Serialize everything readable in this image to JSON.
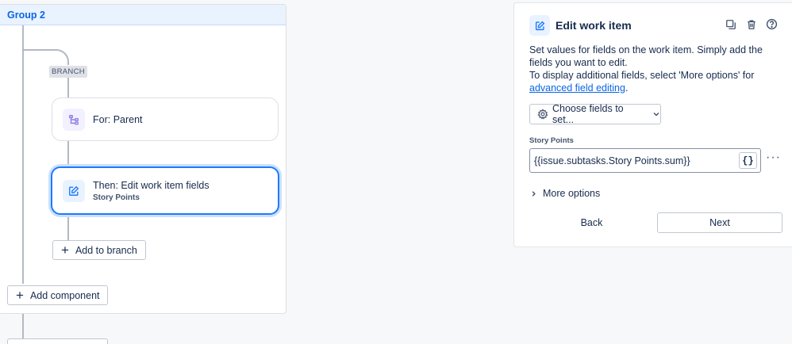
{
  "group": {
    "title": "Group 2"
  },
  "branch": {
    "tag": "BRANCH",
    "for_card": {
      "title": "For: Parent",
      "icon": "branch-icon"
    },
    "then_card": {
      "title": "Then: Edit work item fields",
      "subtitle": "Story Points",
      "icon": "edit-icon"
    },
    "add_to_branch": "Add to branch"
  },
  "add_component": "Add component",
  "panel": {
    "title": "Edit work item",
    "icon": "edit-icon",
    "actions": [
      "duplicate-icon",
      "trash-icon",
      "help-icon"
    ],
    "desc_line1": "Set values for fields on the work item. Simply add the fields you want to edit.",
    "desc_line2": "To display additional fields, select 'More options' for",
    "desc_link": "advanced field editing",
    "desc_end": ".",
    "choose_fields": "Choose fields to set...",
    "field_label": "Story Points",
    "field_value": "{{issue.subtasks.Story Points.sum}}",
    "brace_label": "{}",
    "more_dots": "···",
    "more_options": "More options",
    "back": "Back",
    "next": "Next"
  },
  "colors": {
    "accent": "#1d7afc",
    "link": "#0c66e4",
    "for_icon_bg": "#f3f0ff",
    "for_icon_fg": "#8f7ee7",
    "edit_icon_bg": "#e9f2ff",
    "edit_icon_fg": "#1d7afc"
  }
}
